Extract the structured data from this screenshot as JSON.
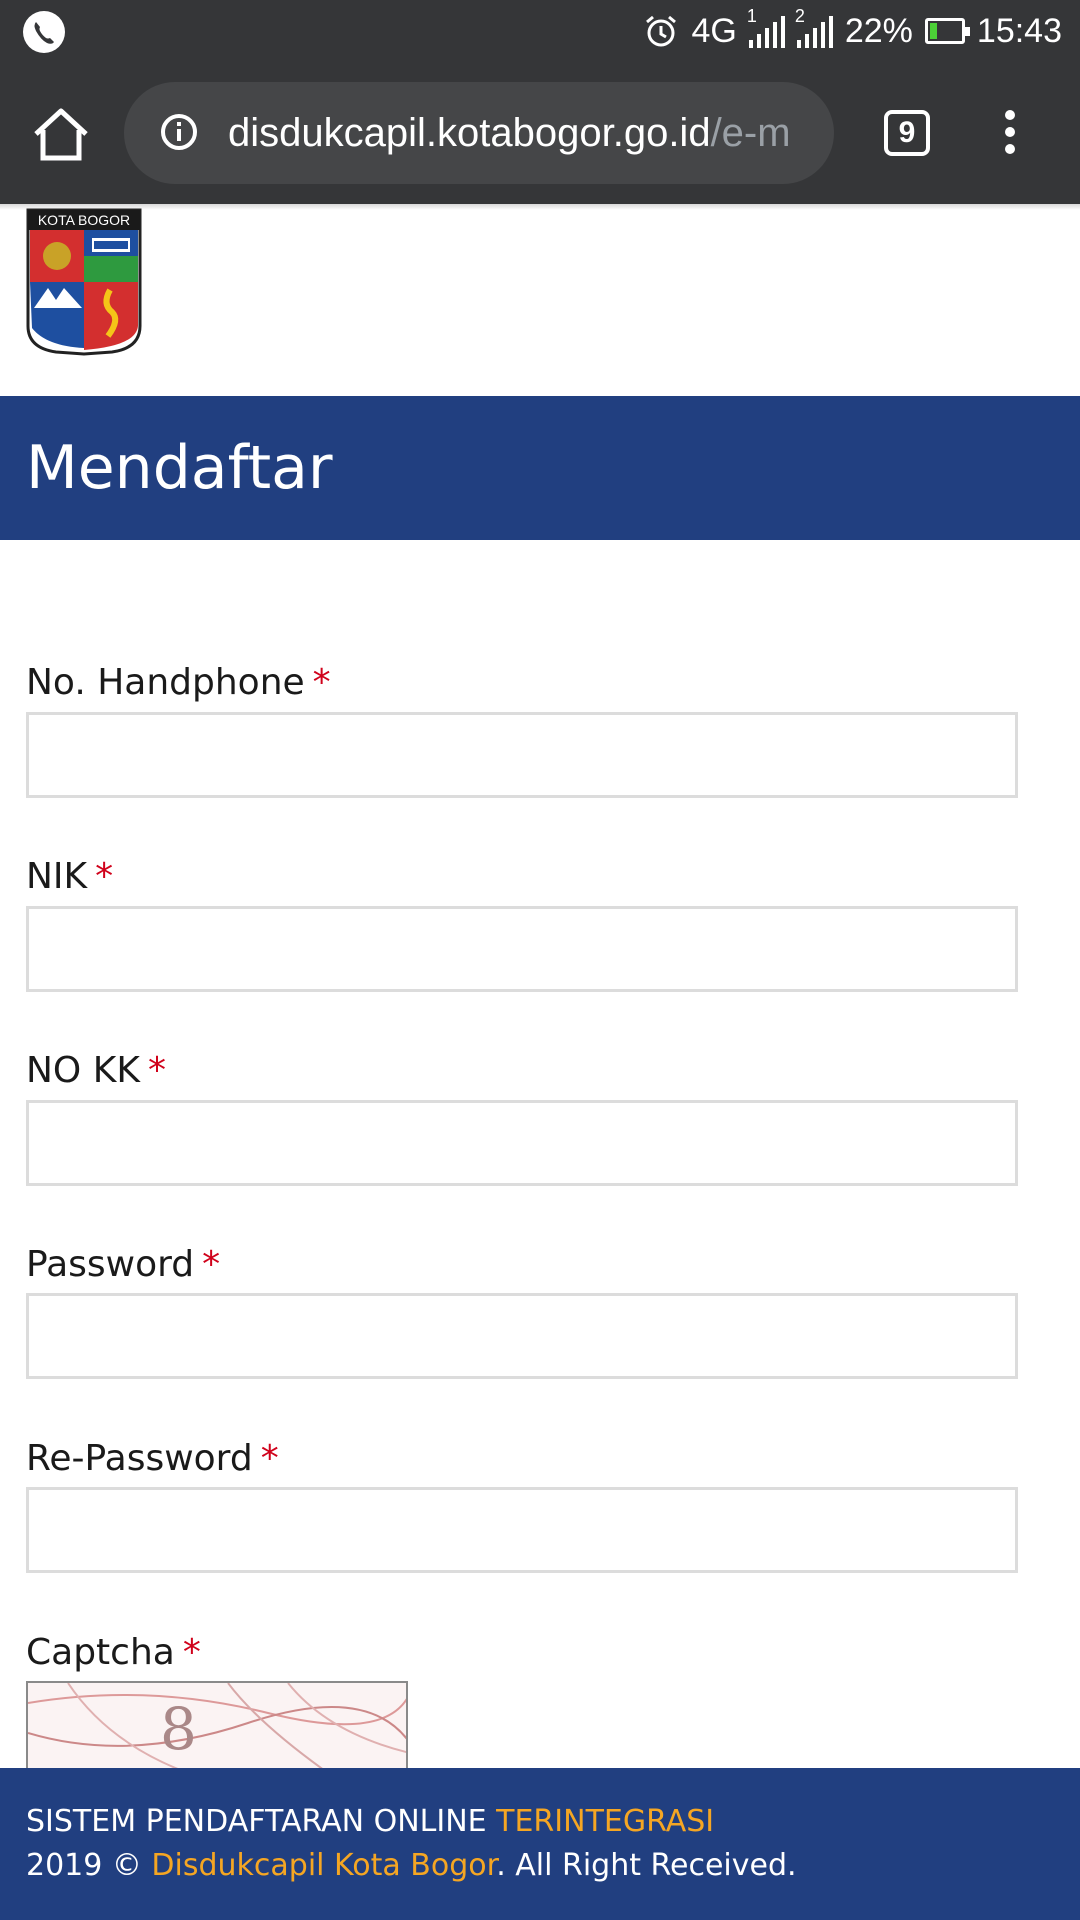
{
  "status_bar": {
    "network": "4G",
    "sim1": "1",
    "sim2": "2",
    "battery": "22%",
    "battery_level": 0.22,
    "time": "15:43",
    "icons": [
      "phone-icon",
      "alarm-icon",
      "signal-icon",
      "battery-icon"
    ]
  },
  "browser": {
    "url_domain": "disdukcapil.kotabogor.go.id",
    "url_path": "/e-m",
    "tab_count": "9",
    "icons": [
      "home-icon",
      "info-icon",
      "tabs-icon",
      "overflow-menu-icon"
    ]
  },
  "logo": {
    "text": "KOTA BOGOR"
  },
  "page": {
    "title": "Mendaftar"
  },
  "form": {
    "required_mark": "*",
    "fields": [
      {
        "label": "No. Handphone",
        "value": ""
      },
      {
        "label": "NIK",
        "value": ""
      },
      {
        "label": "NO KK",
        "value": ""
      },
      {
        "label": "Password",
        "value": ""
      },
      {
        "label": "Re-Password",
        "value": ""
      }
    ],
    "captcha_label": "Captcha",
    "captcha_text": "8"
  },
  "footer": {
    "line1_prefix": "SISTEM PENDAFTARAN ONLINE ",
    "line1_accent": "TERINTEGRASI",
    "line2_prefix": "2019 © ",
    "line2_link": "Disdukcapil Kota Bogor",
    "line2_suffix": ". All Right Received."
  },
  "colors": {
    "brand_blue": "#213f80",
    "accent_orange": "#f5a623",
    "required_red": "#d0021b",
    "browser_chrome": "#353638"
  }
}
